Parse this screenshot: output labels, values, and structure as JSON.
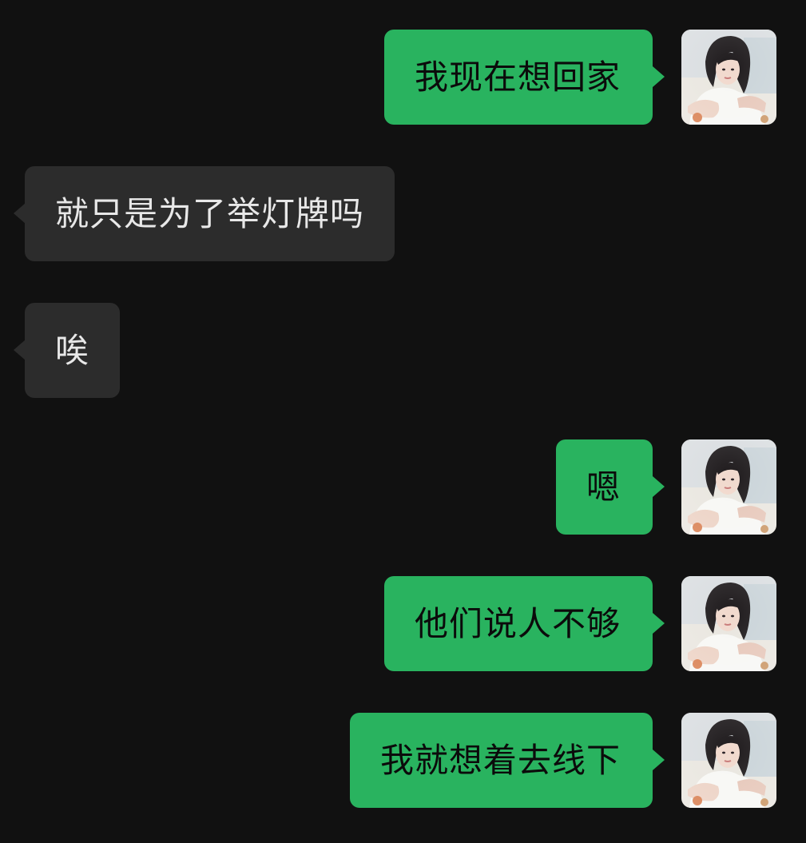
{
  "colors": {
    "background": "#111111",
    "my_bubble": "#29b35f",
    "their_bubble": "#2c2c2c",
    "my_text": "#0b0b0b",
    "their_text": "#e8e8e8"
  },
  "messages": [
    {
      "sender": "me",
      "text": "我现在想回家"
    },
    {
      "sender": "other",
      "text": "就只是为了举灯牌吗"
    },
    {
      "sender": "other",
      "text": "唉"
    },
    {
      "sender": "me",
      "text": "嗯"
    },
    {
      "sender": "me",
      "text": "他们说人不够"
    },
    {
      "sender": "me",
      "text": "我就想着去线下"
    }
  ],
  "avatar_icon": "user-avatar-photo"
}
